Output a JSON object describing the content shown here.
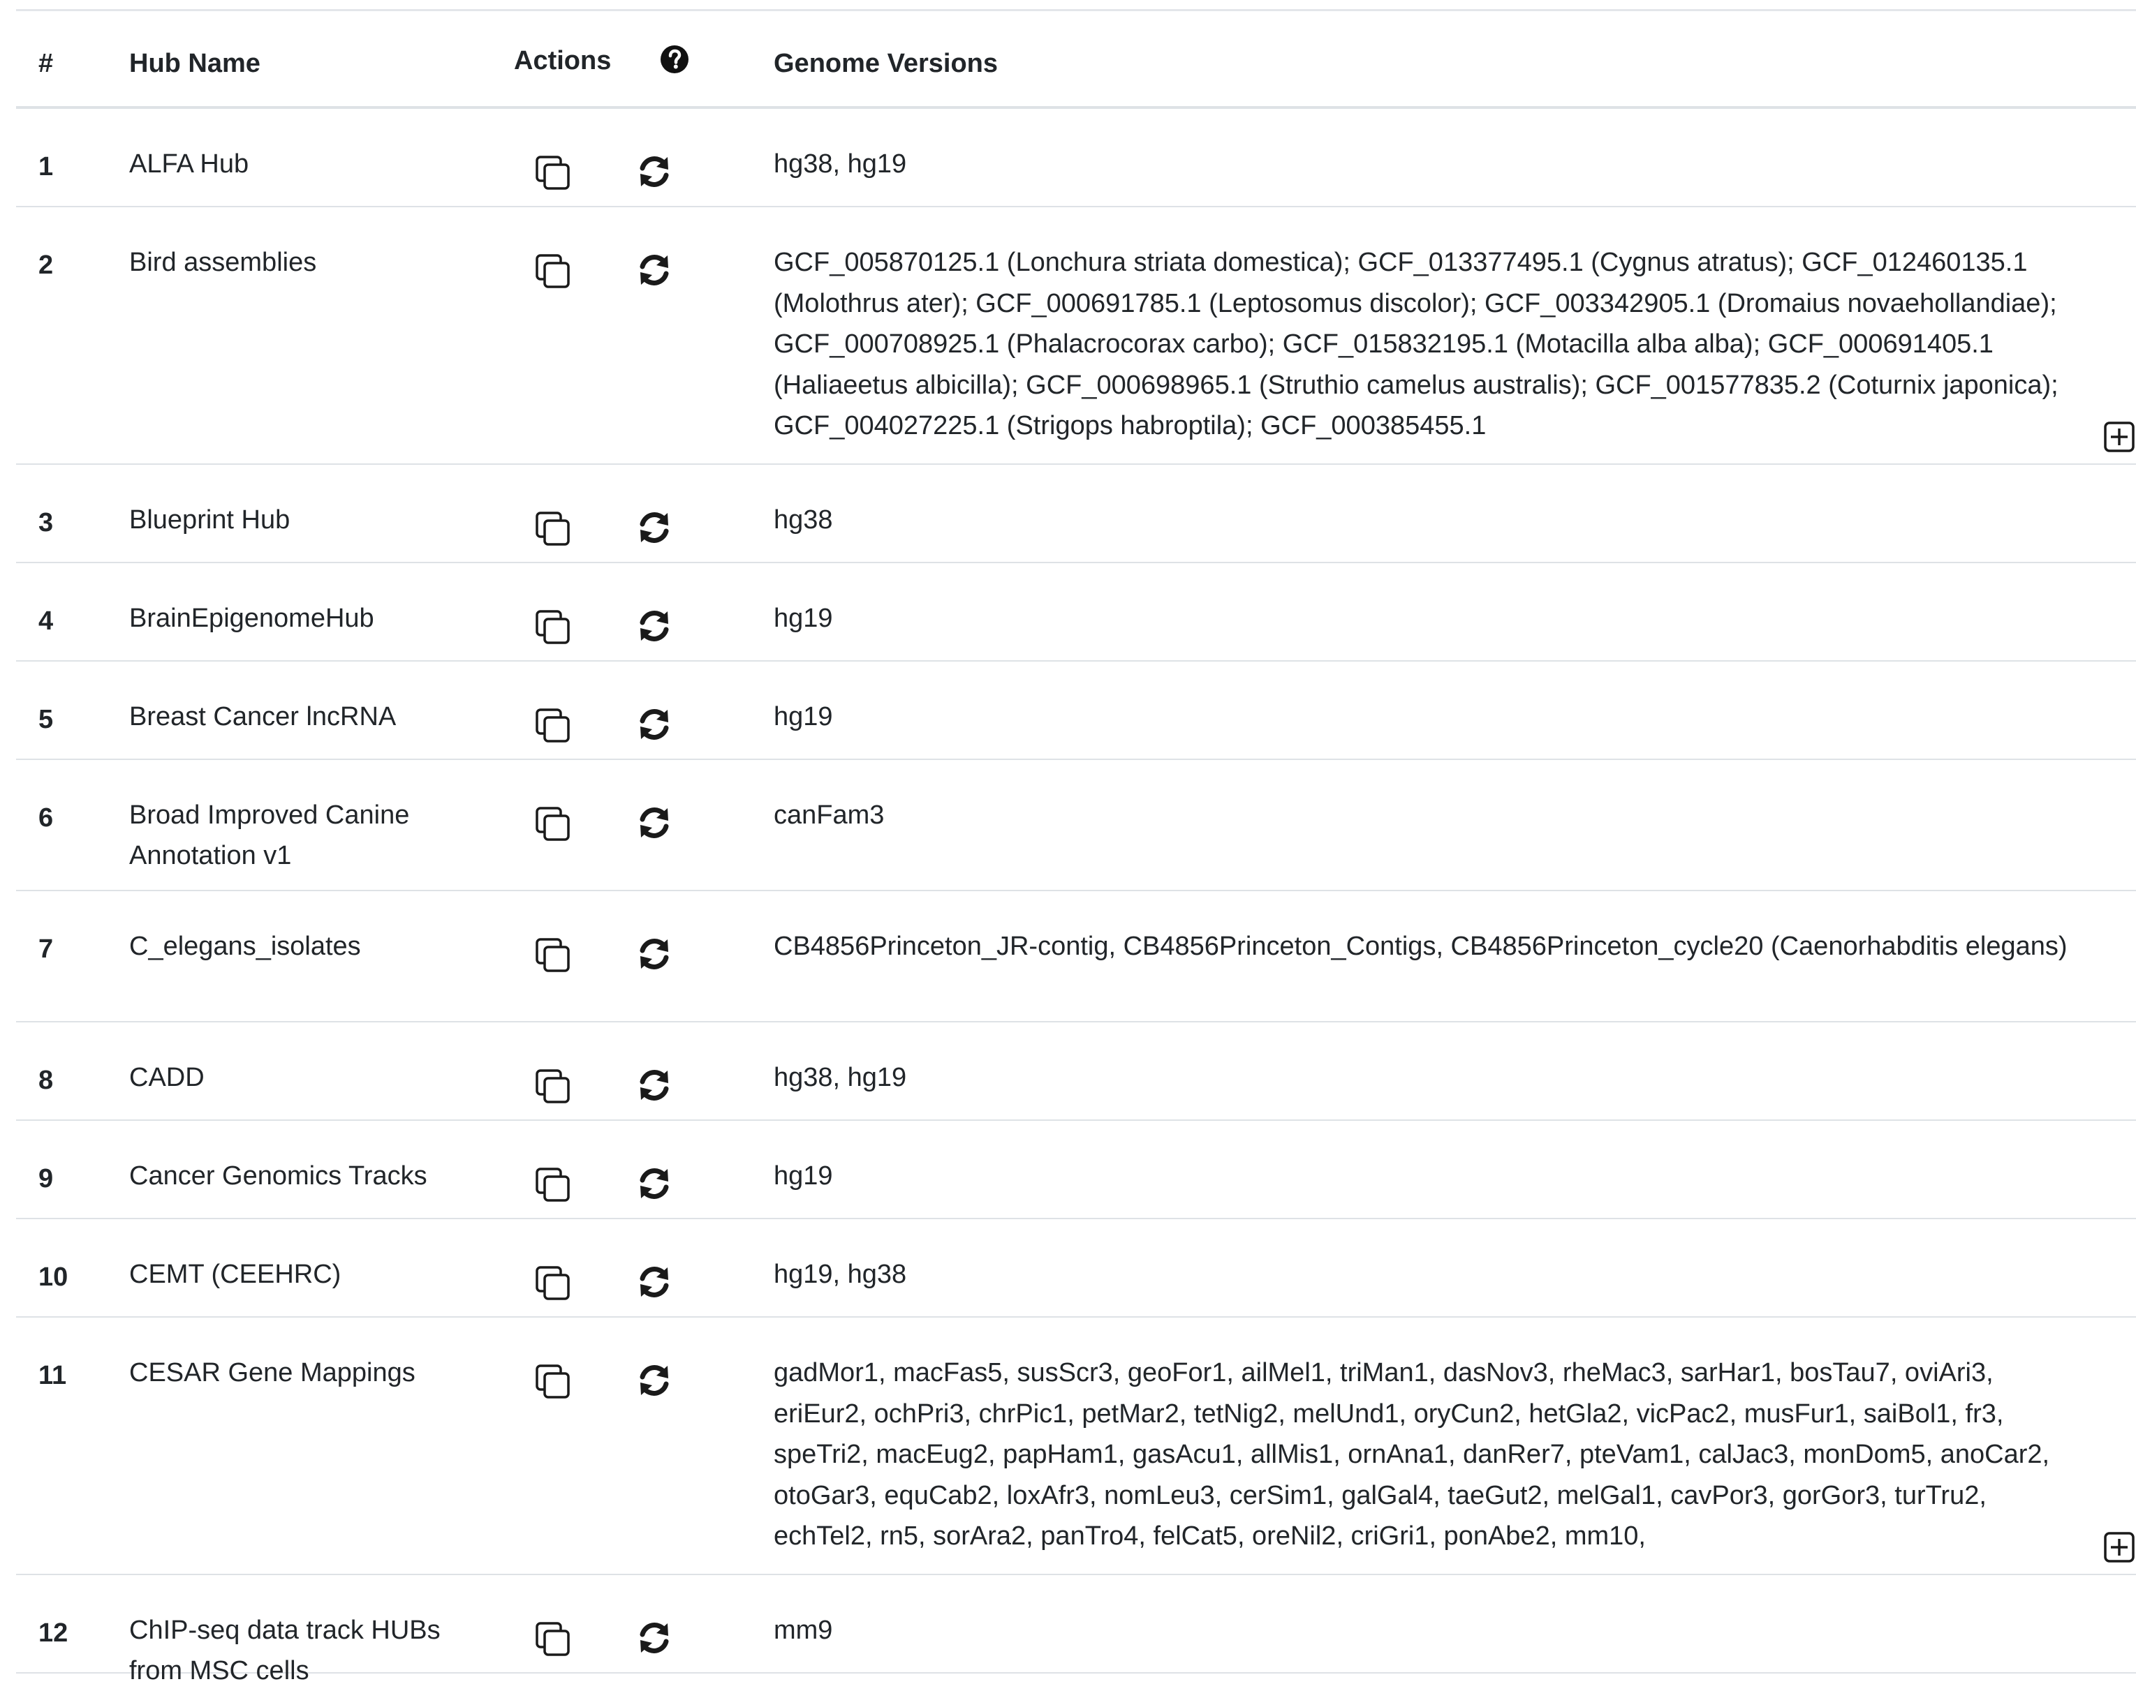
{
  "table": {
    "headers": {
      "number": "#",
      "hub_name": "Hub Name",
      "actions": "Actions",
      "help_icon": "question-circle-icon",
      "genome_versions": "Genome Versions"
    },
    "action_icons": {
      "copy": "copy-icon",
      "refresh": "refresh-icon",
      "expand": "plus-square-icon"
    },
    "rows": [
      {
        "num": "1",
        "name": "ALFA Hub",
        "genomes": "hg38, hg19",
        "expandable": false
      },
      {
        "num": "2",
        "name": "Bird assemblies",
        "genomes": "GCF_005870125.1 (Lonchura striata domestica); GCF_013377495.1 (Cygnus atratus); GCF_012460135.1 (Molothrus ater); GCF_000691785.1 (Leptosomus discolor); GCF_003342905.1 (Dromaius novaehollandiae); GCF_000708925.1 (Phalacrocorax carbo); GCF_015832195.1 (Motacilla alba alba); GCF_000691405.1 (Haliaeetus albicilla); GCF_000698965.1 (Struthio camelus australis); GCF_001577835.2 (Coturnix japonica); GCF_004027225.1 (Strigops habroptila); GCF_000385455.1",
        "expandable": true
      },
      {
        "num": "3",
        "name": "Blueprint Hub",
        "genomes": "hg38",
        "expandable": false
      },
      {
        "num": "4",
        "name": "BrainEpigenomeHub",
        "genomes": "hg19",
        "expandable": false
      },
      {
        "num": "5",
        "name": "Breast Cancer lncRNA",
        "genomes": "hg19",
        "expandable": false
      },
      {
        "num": "6",
        "name": "Broad Improved Canine Annotation v1",
        "genomes": "canFam3",
        "expandable": false
      },
      {
        "num": "7",
        "name": "C_elegans_isolates",
        "genomes": "CB4856Princeton_JR-contig, CB4856Princeton_Contigs, CB4856Princeton_cycle20 (Caenorhabditis elegans)",
        "expandable": false
      },
      {
        "num": "8",
        "name": "CADD",
        "genomes": "hg38, hg19",
        "expandable": false
      },
      {
        "num": "9",
        "name": "Cancer Genomics Tracks",
        "genomes": "hg19",
        "expandable": false
      },
      {
        "num": "10",
        "name": "CEMT (CEEHRC)",
        "genomes": "hg19, hg38",
        "expandable": false
      },
      {
        "num": "11",
        "name": "CESAR Gene Mappings",
        "genomes": "gadMor1, macFas5, susScr3, geoFor1, ailMel1, triMan1, dasNov3, rheMac3, sarHar1, bosTau7, oviAri3, eriEur2, ochPri3, chrPic1, petMar2, tetNig2, melUnd1, oryCun2, hetGla2, vicPac2, musFur1, saiBol1, fr3, speTri2, macEug2, papHam1, gasAcu1, allMis1, ornAna1, danRer7, pteVam1, calJac3, monDom5, anoCar2, otoGar3, equCab2, loxAfr3, nomLeu3, cerSim1, galGal4, taeGut2, melGal1, cavPor3, gorGor3, turTru2, echTel2, rn5, sorAra2, panTro4, felCat5, oreNil2, criGri1, ponAbe2, mm10,",
        "expandable": true
      },
      {
        "num": "12",
        "name": "ChIP-seq data track HUBs from MSC cells",
        "genomes": "mm9",
        "expandable": false
      }
    ]
  }
}
